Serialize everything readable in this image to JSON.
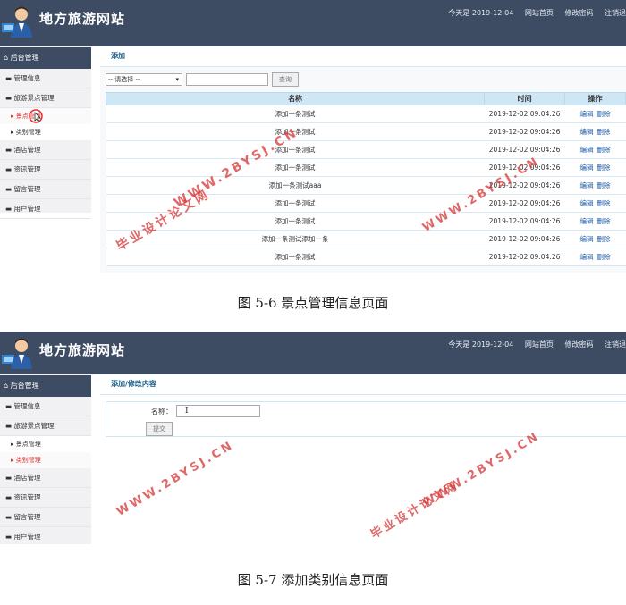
{
  "screenshot1": {
    "header": {
      "site_title": "地方旅游网站",
      "date_text": "今天是 2019-12-04",
      "nav_home": "网站首页",
      "nav_password": "修改密码",
      "nav_logout": "注销退"
    },
    "sidebar": {
      "heading": "后台管理",
      "items": [
        "管理信息",
        "旅游景点管理",
        "景点管理",
        "类别管理",
        "酒店管理",
        "资讯管理",
        "留言管理",
        "用户管理"
      ]
    },
    "main": {
      "title": "添加",
      "select_value": "-- 请选择 --",
      "search_button": "查询",
      "columns": [
        "名称",
        "时间",
        "操作"
      ],
      "rows": [
        {
          "name": "添加一条测试",
          "time": "2019-12-02 09:04:26"
        },
        {
          "name": "添加一条测试",
          "time": "2019-12-02 09:04:26"
        },
        {
          "name": "添加一条测试",
          "time": "2019-12-02 09:04:26"
        },
        {
          "name": "添加一条测试",
          "time": "2019-12-02 09:04:26"
        },
        {
          "name": "添加一条测试aaa",
          "time": "2019-12-02 09:04:26"
        },
        {
          "name": "添加一条测试",
          "time": "2019-12-02 09:04:26"
        },
        {
          "name": "添加一条测试",
          "time": "2019-12-02 09:04:26"
        },
        {
          "name": "添加一条测试添加一条",
          "time": "2019-12-02 09:04:26"
        },
        {
          "name": "添加一条测试",
          "time": "2019-12-02 09:04:26"
        }
      ],
      "edit_label": "编辑",
      "delete_label": "删除"
    },
    "caption": "图 5-6 景点管理信息页面"
  },
  "screenshot2": {
    "header": {
      "site_title": "地方旅游网站",
      "date_text": "今天是 2019-12-04",
      "nav_home": "网站首页",
      "nav_password": "修改密码",
      "nav_logout": "注销退"
    },
    "sidebar": {
      "heading": "后台管理",
      "items": [
        "管理信息",
        "旅游景点管理",
        "景点管理",
        "类别管理",
        "酒店管理",
        "资讯管理",
        "留言管理",
        "用户管理"
      ]
    },
    "main": {
      "title": "添加/修改内容",
      "name_label": "名称：",
      "submit_button": "提交"
    },
    "caption": "图 5-7 添加类别信息页面"
  },
  "watermarks": {
    "url": "WWW.2BYSJ.CN",
    "site_name": "毕业设计论文网"
  },
  "colors": {
    "header_bg": "#3e4c63",
    "table_header_bg": "#cfe6f5",
    "link": "#1a5aa6",
    "active_item": "#e03030",
    "watermark": "#d73c3c"
  }
}
